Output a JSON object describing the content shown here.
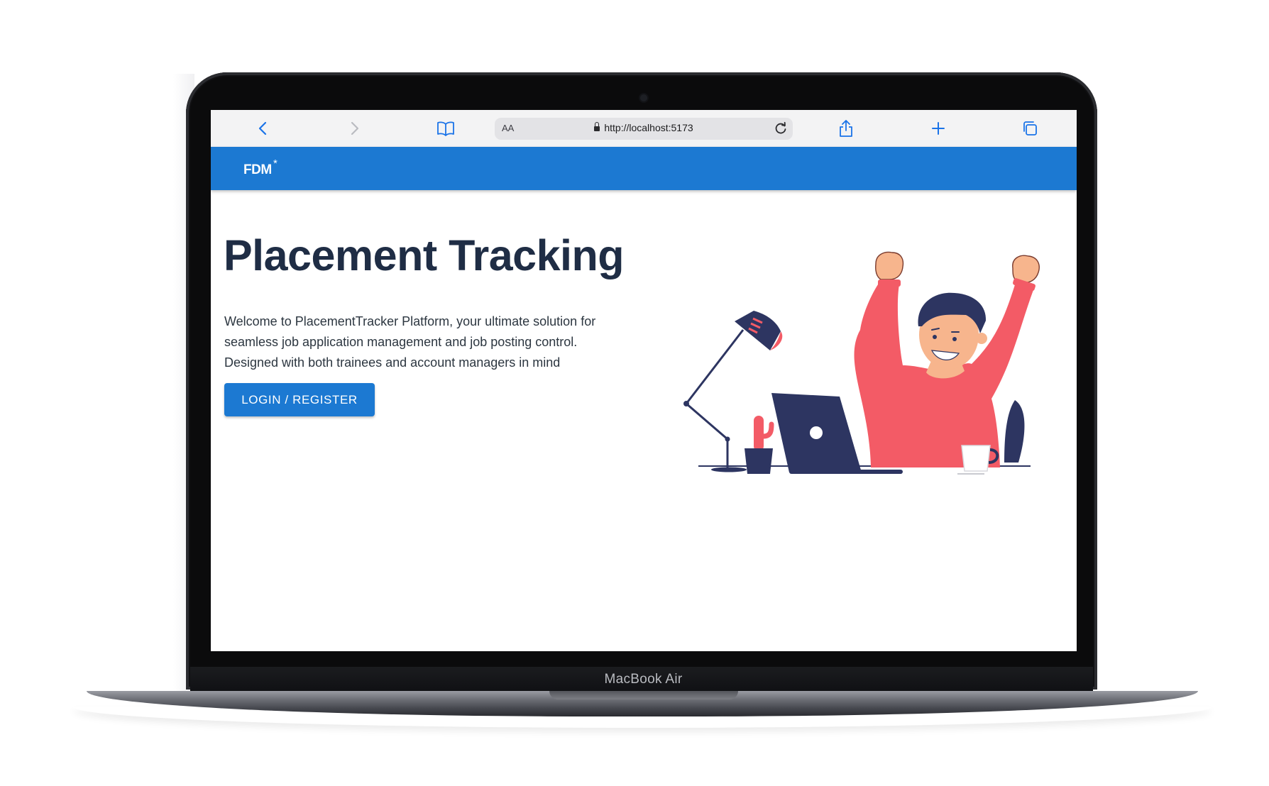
{
  "device": {
    "model_label": "MacBook Air"
  },
  "browser": {
    "text_size_label": "AA",
    "url": "http://localhost:5173",
    "icons": [
      "back-icon",
      "forward-icon",
      "bookmarks-icon",
      "lock-icon",
      "reload-icon",
      "share-icon",
      "new-tab-icon",
      "tabs-icon"
    ]
  },
  "app": {
    "logo_text": "FDM",
    "logo_mark": "*",
    "brand_color": "#1c79d2"
  },
  "hero": {
    "title": "Placement Tracking",
    "description": "Welcome to PlacementTracker Platform, your ultimate solution for seamless job application management and job posting control. Designed with both trainees and account managers in mind",
    "cta_label": "LOGIN / REGISTER"
  },
  "illustration": {
    "subject": "person-celebrating-at-laptop",
    "colors": {
      "shirt": "#f35b66",
      "laptop": "#2d3561",
      "hair": "#2d3561",
      "skin": "#f7b58d"
    }
  }
}
